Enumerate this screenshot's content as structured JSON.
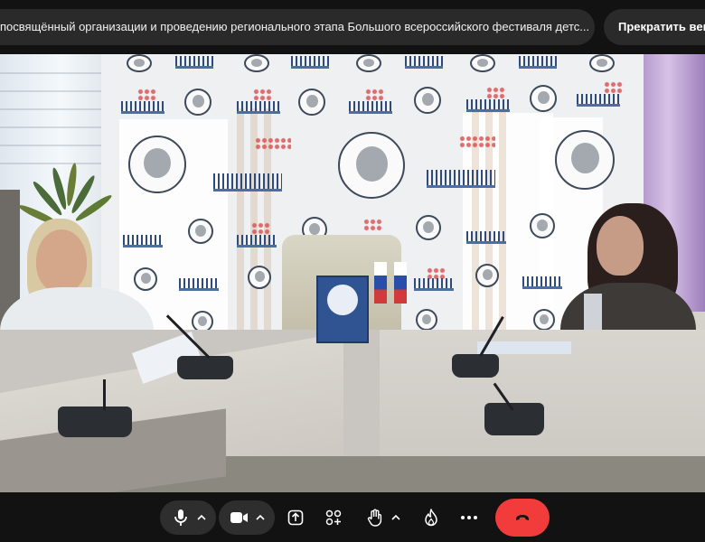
{
  "header": {
    "conference_title": "посвящённый организации и проведению регионального этапа Большого всероссийского фестиваля детс...",
    "stop_label": "Прекратить веш"
  },
  "toolbar": {
    "mic_icon": "microphone-icon",
    "camera_icon": "camera-icon",
    "share_icon": "screen-share-icon",
    "apps_icon": "add-apps-icon",
    "hand_icon": "raise-hand-icon",
    "reaction_icon": "fire-reaction-icon",
    "more_icon": "more-dots-icon",
    "hangup_icon": "phone-hangup-icon"
  },
  "colors": {
    "background": "#121212",
    "pill": "#2a2a2a",
    "control_group": "#2e2e2e",
    "hangup": "#f23b3b",
    "icon": "#ffffff"
  }
}
